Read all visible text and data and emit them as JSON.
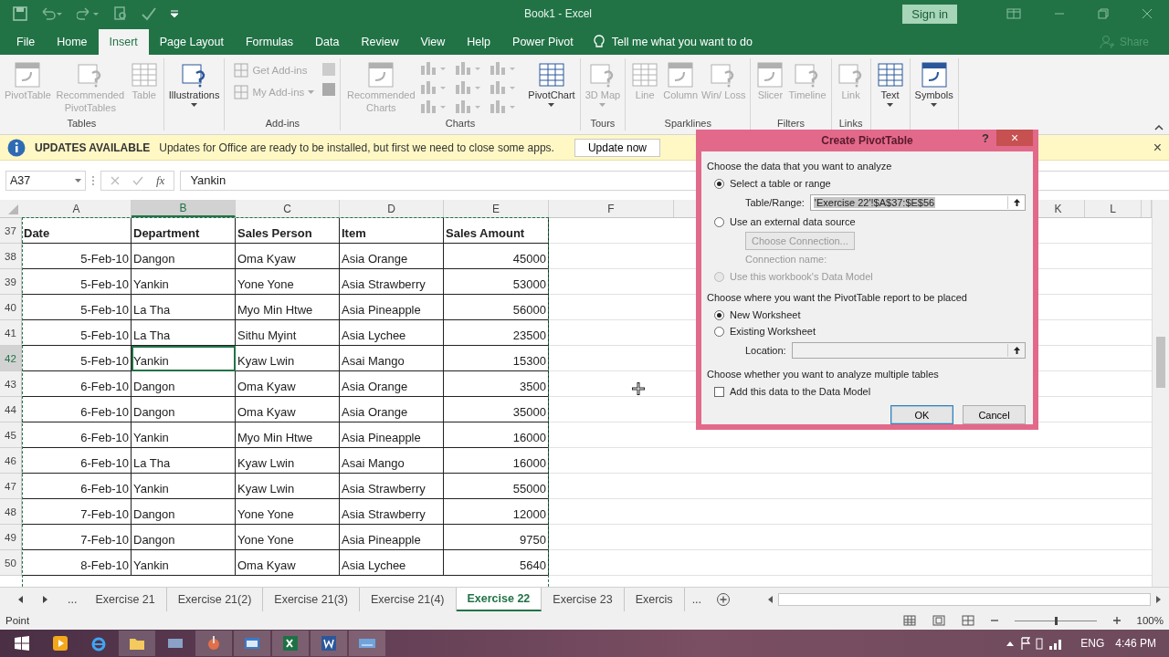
{
  "window": {
    "title": "Book1 - Excel",
    "sign_in": "Sign in"
  },
  "tabs": [
    {
      "label": "File",
      "selected": false
    },
    {
      "label": "Home",
      "selected": false
    },
    {
      "label": "Insert",
      "selected": true
    },
    {
      "label": "Page Layout",
      "selected": false
    },
    {
      "label": "Formulas",
      "selected": false
    },
    {
      "label": "Data",
      "selected": false
    },
    {
      "label": "Review",
      "selected": false
    },
    {
      "label": "View",
      "selected": false
    },
    {
      "label": "Help",
      "selected": false
    },
    {
      "label": "Power Pivot",
      "selected": false
    }
  ],
  "tell_me": {
    "placeholder": "Tell me what you want to do"
  },
  "share": "Share",
  "ribbon": {
    "groups": [
      {
        "label": "Tables",
        "items": [
          {
            "kind": "large",
            "label": "PivotTable",
            "disabled": true,
            "dropdown": false
          },
          {
            "kind": "large",
            "label": "Recommended PivotTables",
            "disabled": true,
            "dropdown": false
          },
          {
            "kind": "large",
            "label": "Table",
            "disabled": true,
            "dropdown": false
          }
        ]
      },
      {
        "items": [
          {
            "kind": "large",
            "label": "Illustrations",
            "disabled": false,
            "dropdown": true
          }
        ]
      },
      {
        "label": "Add-ins",
        "items": [
          {
            "kind": "small",
            "label": "Get Add-ins",
            "disabled": true,
            "dropdown": false
          },
          {
            "kind": "small",
            "label": "My Add-ins",
            "disabled": true,
            "dropdown": true
          }
        ]
      },
      {
        "label": "Charts",
        "items": [
          {
            "kind": "large",
            "label": "Recommended Charts",
            "disabled": true,
            "dropdown": false
          },
          {
            "kind": "chart-types"
          },
          {
            "kind": "large",
            "label": "PivotChart",
            "disabled": false,
            "dropdown": true
          }
        ]
      },
      {
        "label": "Tours",
        "items": [
          {
            "kind": "large",
            "label": "3D Map",
            "disabled": true,
            "dropdown": true
          }
        ]
      },
      {
        "label": "Sparklines",
        "items": [
          {
            "kind": "large",
            "label": "Line",
            "disabled": true,
            "dropdown": false
          },
          {
            "kind": "large",
            "label": "Column",
            "disabled": true,
            "dropdown": false
          },
          {
            "kind": "large",
            "label": "Win/ Loss",
            "disabled": true,
            "dropdown": false
          }
        ]
      },
      {
        "label": "Filters",
        "items": [
          {
            "kind": "large",
            "label": "Slicer",
            "disabled": true,
            "dropdown": false
          },
          {
            "kind": "large",
            "label": "Timeline",
            "disabled": true,
            "dropdown": false
          }
        ]
      },
      {
        "label": "Links",
        "items": [
          {
            "kind": "large",
            "label": "Link",
            "disabled": true,
            "dropdown": false
          }
        ]
      },
      {
        "items": [
          {
            "kind": "large",
            "label": "Text",
            "disabled": false,
            "dropdown": true
          }
        ]
      },
      {
        "items": [
          {
            "kind": "large",
            "label": "Symbols",
            "disabled": false,
            "dropdown": true
          }
        ]
      }
    ]
  },
  "update_bar": {
    "title": "UPDATES AVAILABLE",
    "message": "Updates for Office are ready to be installed, but first we need to close some apps.",
    "button": "Update now",
    "close": "×"
  },
  "formula_bar": {
    "name_box": "A37",
    "function_button": "fx",
    "value": "Yankin"
  },
  "sheet": {
    "columns": [
      {
        "label": "A",
        "selected": false
      },
      {
        "label": "B",
        "selected": true
      },
      {
        "label": "C",
        "selected": false
      },
      {
        "label": "D",
        "selected": false
      },
      {
        "label": "E",
        "selected": false
      },
      {
        "label": "F",
        "selected": false
      },
      {
        "label": "K",
        "selected": false
      },
      {
        "label": "L",
        "selected": false
      }
    ],
    "rows": [
      {
        "number": "37",
        "kind": "header",
        "selected": false,
        "cells": [
          "Date",
          "Department",
          "Sales Person",
          "Item",
          "Sales Amount"
        ]
      },
      {
        "number": "38",
        "kind": "data",
        "selected": false,
        "cells": [
          "5-Feb-10",
          "Dangon",
          "Oma Kyaw",
          "Asia Orange",
          "45000"
        ]
      },
      {
        "number": "39",
        "kind": "data",
        "selected": false,
        "cells": [
          "5-Feb-10",
          "Yankin",
          "Yone Yone",
          "Asia Strawberry",
          "53000"
        ]
      },
      {
        "number": "40",
        "kind": "data",
        "selected": false,
        "cells": [
          "5-Feb-10",
          "La Tha",
          "Myo Min Htwe",
          "Asia Pineapple",
          "56000"
        ]
      },
      {
        "number": "41",
        "kind": "data",
        "selected": false,
        "cells": [
          "5-Feb-10",
          "La Tha",
          "Sithu Myint",
          "Asia Lychee",
          "23500"
        ]
      },
      {
        "number": "42",
        "kind": "data",
        "selected": true,
        "cells": [
          "5-Feb-10",
          "Yankin",
          "Kyaw Lwin",
          "Asai Mango",
          "15300"
        ]
      },
      {
        "number": "43",
        "kind": "data",
        "selected": false,
        "cells": [
          "6-Feb-10",
          "Dangon",
          "Oma Kyaw",
          "Asia Orange",
          "3500"
        ]
      },
      {
        "number": "44",
        "kind": "data",
        "selected": false,
        "cells": [
          "6-Feb-10",
          "Dangon",
          "Oma Kyaw",
          "Asia Orange",
          "35000"
        ]
      },
      {
        "number": "45",
        "kind": "data",
        "selected": false,
        "cells": [
          "6-Feb-10",
          "Yankin",
          "Myo Min Htwe",
          "Asia Pineapple",
          "16000"
        ]
      },
      {
        "number": "46",
        "kind": "data",
        "selected": false,
        "cells": [
          "6-Feb-10",
          "La Tha",
          "Kyaw Lwin",
          "Asai Mango",
          "16000"
        ]
      },
      {
        "number": "47",
        "kind": "data",
        "selected": false,
        "cells": [
          "6-Feb-10",
          "Yankin",
          "Kyaw Lwin",
          "Asia Strawberry",
          "55000"
        ]
      },
      {
        "number": "48",
        "kind": "data",
        "selected": false,
        "cells": [
          "7-Feb-10",
          "Dangon",
          "Yone Yone",
          "Asia Strawberry",
          "12000"
        ]
      },
      {
        "number": "49",
        "kind": "data",
        "selected": false,
        "cells": [
          "7-Feb-10",
          "Dangon",
          "Yone Yone",
          "Asia Pineapple",
          "9750"
        ]
      },
      {
        "number": "50",
        "kind": "data",
        "selected": false,
        "cells": [
          "8-Feb-10",
          "Yankin",
          "Oma Kyaw",
          "Asia Lychee",
          "5640"
        ]
      }
    ]
  },
  "sheet_tabs": {
    "more_left": "...",
    "tabs": [
      {
        "label": "Exercise 21",
        "selected": false
      },
      {
        "label": "Exercise 21(2)",
        "selected": false
      },
      {
        "label": "Exercise 21(3)",
        "selected": false
      },
      {
        "label": "Exercise 21(4)",
        "selected": false
      },
      {
        "label": "Exercise 22",
        "selected": true
      },
      {
        "label": "Exercise 23",
        "selected": false
      },
      {
        "label": "Exercis",
        "selected": false
      }
    ],
    "more_right": "..."
  },
  "status_bar": {
    "mode": "Point",
    "zoom": {
      "level": 0.5,
      "reading": "100%"
    }
  },
  "dialog": {
    "title": "Create PivotTable",
    "help": "?",
    "close": "×",
    "section_1": "Choose the data that you want to analyze",
    "source_options": [
      {
        "label": "Select a table or range",
        "selected": true,
        "disabled": false
      },
      {
        "label": "Use an external data source",
        "selected": false,
        "disabled": false
      },
      {
        "label": "Use this workbook's Data Model",
        "selected": false,
        "disabled": true
      }
    ],
    "range_label": "Table/Range:",
    "range_value": "'Exercise 22'!$A$37:$E$56",
    "choose_connection": {
      "label": "Choose Connection...",
      "disabled": true
    },
    "connection_name": "Connection name:",
    "section_2": "Choose where you want the PivotTable report to be placed",
    "placement_options": [
      {
        "label": "New Worksheet",
        "selected": true
      },
      {
        "label": "Existing Worksheet",
        "selected": false
      }
    ],
    "location_label": "Location:",
    "section_3": "Choose whether you want to analyze multiple tables",
    "data_model": {
      "label": "Add this data to the Data Model",
      "checked": false
    },
    "ok": "OK",
    "cancel": "Cancel"
  },
  "taskbar": {
    "language": "ENG",
    "time": "4:46 PM"
  }
}
